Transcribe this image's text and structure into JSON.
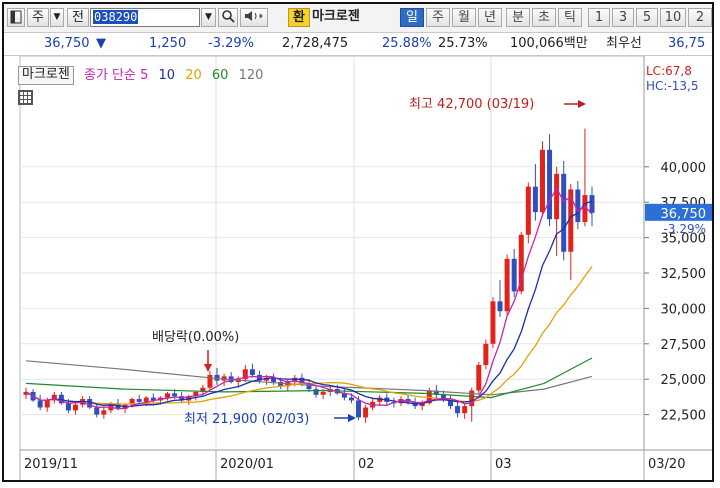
{
  "toolbar": {
    "market": "주",
    "prefix": "전",
    "code": "038290",
    "exchange_label": "환",
    "stock_name": "마크로젠",
    "periods": [
      "일",
      "주",
      "월",
      "년",
      "분",
      "초",
      "틱"
    ],
    "selected_period": "일",
    "minute_values": [
      "1",
      "3",
      "5",
      "10",
      "2"
    ]
  },
  "quote": {
    "price": "36,750",
    "direction_icon": "down-triangle-icon",
    "change": "1,250",
    "change_pct": "-3.29%",
    "volume": "2,728,475",
    "ratio1": "25.88%",
    "ratio2": "25.73%",
    "market_cap": "100,066백만",
    "sort_label": "최우선",
    "best_price": "36,75"
  },
  "legend": {
    "name": "마크로젠",
    "ma_label": "종가 단순 5",
    "ma_periods": [
      "10",
      "20",
      "60",
      "120"
    ]
  },
  "colors": {
    "up": "#e2231a",
    "down": "#2f4fc0",
    "ma5": "#c724b1",
    "ma10": "#1b2fa8",
    "ma20": "#e0a400",
    "ma60": "#1f8a2b",
    "ma120": "#777777",
    "price_tag": "#2c6fd6"
  },
  "chart_data": {
    "type": "candlestick",
    "ylim": [
      20000,
      45000
    ],
    "yticks": [
      "40,000",
      "37,500",
      "35,000",
      "32,500",
      "30,000",
      "27,500",
      "25,000",
      "22,500"
    ],
    "ytick_values": [
      40000,
      37500,
      35000,
      32500,
      30000,
      27500,
      25000,
      22500
    ],
    "xticks": [
      "2019/11",
      "2020/01",
      "02",
      "03",
      "03/20"
    ],
    "lc_label": "LC:67,8",
    "hc_label": "HC:-13,5",
    "current_price": "36,750",
    "current_change": "-3.29%",
    "high_annotation": "최고 42,700 (03/19)",
    "low_annotation": "최저 21,900 (02/03)",
    "dividend_annotation": "배당락(0.00%)",
    "candles": [
      [
        23900,
        24400,
        23600,
        24100
      ],
      [
        24100,
        24300,
        23400,
        23500
      ],
      [
        23500,
        23900,
        22800,
        23000
      ],
      [
        23000,
        23700,
        22700,
        23500
      ],
      [
        23500,
        24100,
        23300,
        23900
      ],
      [
        23900,
        24100,
        23200,
        23300
      ],
      [
        23300,
        23600,
        22600,
        22800
      ],
      [
        22800,
        23400,
        22500,
        23200
      ],
      [
        23200,
        23800,
        23000,
        23600
      ],
      [
        23600,
        23800,
        22900,
        23000
      ],
      [
        23000,
        23300,
        22300,
        22500
      ],
      [
        22500,
        23000,
        22200,
        22800
      ],
      [
        22800,
        23400,
        22600,
        23300
      ],
      [
        23300,
        23600,
        22800,
        22900
      ],
      [
        22900,
        23300,
        22600,
        23200
      ],
      [
        23200,
        23700,
        23000,
        23600
      ],
      [
        23600,
        23900,
        23300,
        23400
      ],
      [
        23400,
        23800,
        23100,
        23700
      ],
      [
        23700,
        24000,
        23300,
        23500
      ],
      [
        23500,
        23800,
        23200,
        23700
      ],
      [
        23700,
        24100,
        23500,
        24000
      ],
      [
        24000,
        24300,
        23600,
        23800
      ],
      [
        23800,
        24100,
        23300,
        23500
      ],
      [
        23500,
        23900,
        23200,
        23800
      ],
      [
        23800,
        24200,
        23500,
        24100
      ],
      [
        24100,
        24600,
        23900,
        24400
      ],
      [
        24400,
        25600,
        24200,
        25300
      ],
      [
        25300,
        25800,
        24600,
        24900
      ],
      [
        24900,
        25400,
        24500,
        25200
      ],
      [
        25200,
        25500,
        24700,
        24800
      ],
      [
        24800,
        25200,
        24400,
        25000
      ],
      [
        25000,
        26000,
        24800,
        25700
      ],
      [
        25700,
        26100,
        25100,
        25300
      ],
      [
        25300,
        25600,
        24700,
        24900
      ],
      [
        24900,
        25300,
        24600,
        25100
      ],
      [
        25100,
        25400,
        24600,
        24800
      ],
      [
        24800,
        25100,
        24300,
        24500
      ],
      [
        24500,
        25000,
        24200,
        24800
      ],
      [
        24800,
        25300,
        24500,
        25100
      ],
      [
        25100,
        25400,
        24500,
        24700
      ],
      [
        24700,
        25000,
        24100,
        24300
      ],
      [
        24300,
        24600,
        23700,
        23900
      ],
      [
        23900,
        24300,
        23600,
        24100
      ],
      [
        24100,
        24500,
        23800,
        24300
      ],
      [
        24300,
        24600,
        23900,
        24000
      ],
      [
        24000,
        24300,
        23500,
        23700
      ],
      [
        23700,
        24000,
        23300,
        23500
      ],
      [
        23500,
        23800,
        22100,
        22300
      ],
      [
        22300,
        23200,
        21900,
        23000
      ],
      [
        23000,
        23600,
        22800,
        23400
      ],
      [
        23400,
        23900,
        23100,
        23700
      ],
      [
        23700,
        24000,
        23200,
        23400
      ],
      [
        23400,
        23700,
        23000,
        23300
      ],
      [
        23300,
        23800,
        23100,
        23600
      ],
      [
        23600,
        23900,
        23200,
        23400
      ],
      [
        23400,
        23700,
        22900,
        23100
      ],
      [
        23100,
        23500,
        22800,
        23300
      ],
      [
        23300,
        24400,
        23200,
        24200
      ],
      [
        24200,
        24600,
        23700,
        23900
      ],
      [
        23900,
        24200,
        23400,
        23600
      ],
      [
        23600,
        23900,
        22900,
        23100
      ],
      [
        23100,
        23400,
        22300,
        22600
      ],
      [
        22600,
        23300,
        22200,
        23100
      ],
      [
        23100,
        24400,
        22000,
        24200
      ],
      [
        24200,
        26200,
        24000,
        26000
      ],
      [
        26000,
        27800,
        25700,
        27500
      ],
      [
        27500,
        30800,
        27200,
        30500
      ],
      [
        30500,
        32000,
        29400,
        29800
      ],
      [
        29800,
        33800,
        29500,
        33500
      ],
      [
        33500,
        34200,
        30800,
        31200
      ],
      [
        31200,
        35400,
        31000,
        35200
      ],
      [
        35200,
        38900,
        34600,
        38600
      ],
      [
        38600,
        40200,
        36200,
        36800
      ],
      [
        36800,
        41800,
        36500,
        41200
      ],
      [
        41200,
        42300,
        35800,
        36300
      ],
      [
        36300,
        40000,
        33700,
        39500
      ],
      [
        39500,
        40400,
        33400,
        34000
      ],
      [
        34000,
        38800,
        32000,
        38400
      ],
      [
        38400,
        39000,
        35600,
        36100
      ],
      [
        36100,
        42700,
        35800,
        38000
      ],
      [
        38000,
        38600,
        35800,
        36750
      ]
    ]
  }
}
